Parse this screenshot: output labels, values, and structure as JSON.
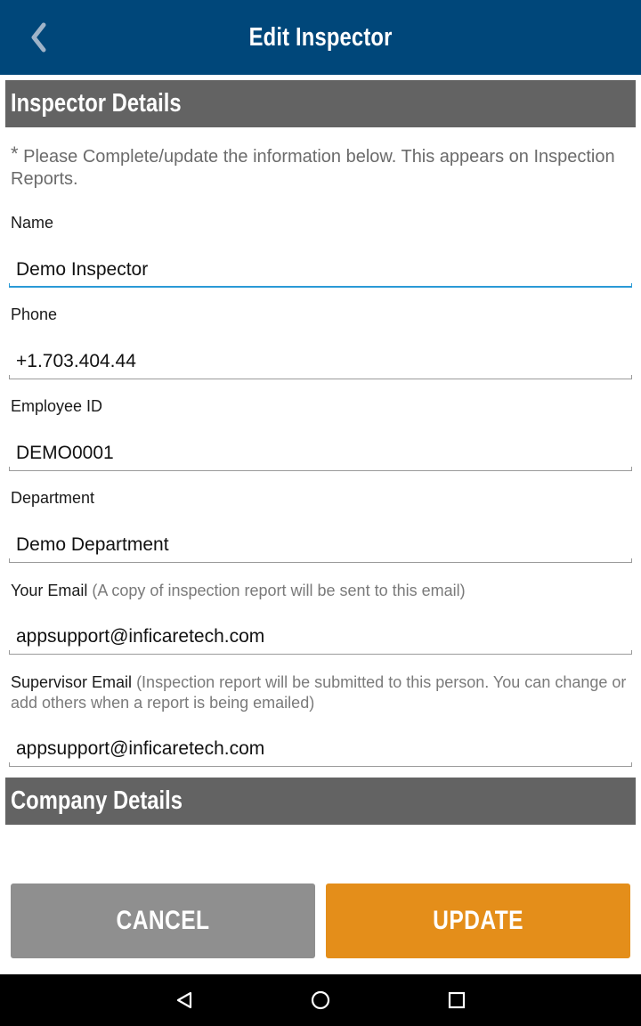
{
  "colors": {
    "brand": "#00477a",
    "accent": "#e48e1a",
    "focus": "#2a9ad6",
    "section_header": "#636363",
    "cancel": "#8f8f8f"
  },
  "appbar": {
    "title": "Edit Inspector",
    "back_icon": "chevron-left-icon"
  },
  "inspector_section": {
    "title": "Inspector Details",
    "required_mark": "*",
    "intro": "Please Complete/update the information below. This appears on Inspection Reports.",
    "fields": [
      {
        "label": "Name",
        "hint": "",
        "value": "Demo Inspector"
      },
      {
        "label": "Phone",
        "hint": "",
        "value": "+1.703.404.44"
      },
      {
        "label": "Employee ID",
        "hint": "",
        "value": "DEMO0001"
      },
      {
        "label": "Department",
        "hint": "",
        "value": "Demo Department"
      },
      {
        "label": "Your Email",
        "hint": "(A copy of inspection report will be sent to this email)",
        "value": "appsupport@inficaretech.com"
      },
      {
        "label": "Supervisor Email",
        "hint": "(Inspection report will be submitted to this person. You can change or add others when a report is being emailed)",
        "value": "appsupport@inficaretech.com"
      }
    ]
  },
  "company_section": {
    "title": "Company Details"
  },
  "actions": {
    "cancel_label": "CANCEL",
    "update_label": "UPDATE"
  },
  "system_nav": {
    "back_icon": "nav-back-icon",
    "home_icon": "nav-home-icon",
    "recents_icon": "nav-recents-icon"
  }
}
